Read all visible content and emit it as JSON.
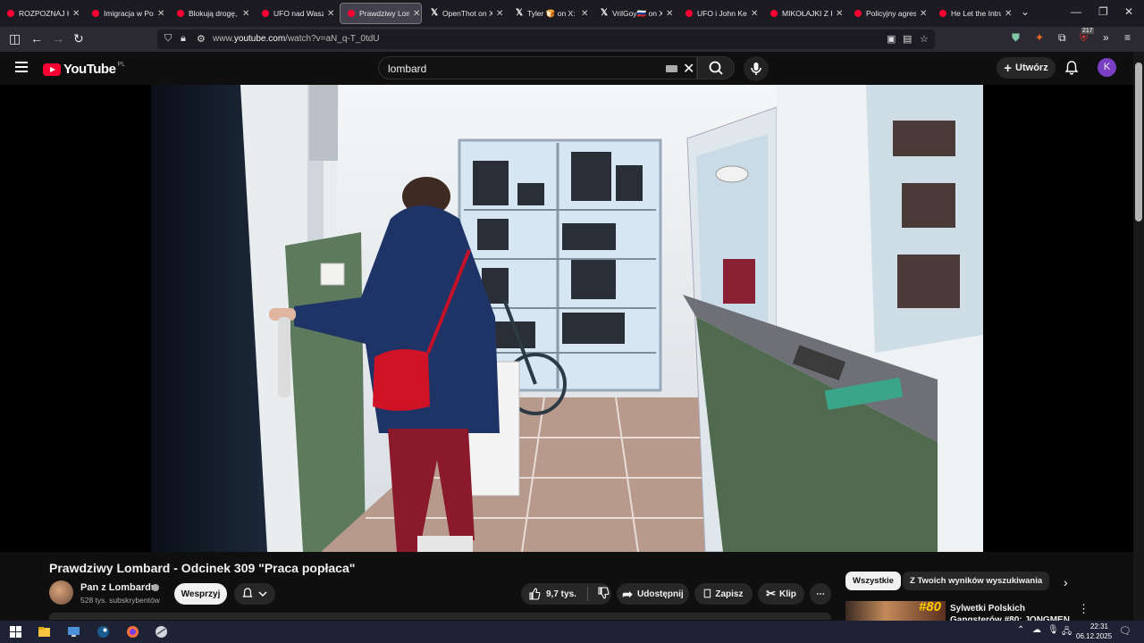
{
  "browser": {
    "tabs": [
      {
        "label": "ROZPOZNAJ KO",
        "icon": "youtube-icon"
      },
      {
        "label": "Imigracja w Pols",
        "icon": "youtube-icon"
      },
      {
        "label": "Blokują drogę, z",
        "icon": "youtube-icon"
      },
      {
        "label": "UFO nad Waszyn",
        "icon": "youtube-icon"
      },
      {
        "label": "Prawdziwy Lomb",
        "icon": "youtube-icon",
        "active": true
      },
      {
        "label": "OpenThot on X: ",
        "icon": "x-icon"
      },
      {
        "label": "Tyler 🍞 on X: \"I",
        "icon": "x-icon"
      },
      {
        "label": "VrilGoy🇷🇺 on X: ",
        "icon": "x-icon"
      },
      {
        "label": "UFO i John Kenn",
        "icon": "youtube-icon"
      },
      {
        "label": "MIKOŁAJKI Z KA",
        "icon": "youtube-icon"
      },
      {
        "label": "Policyjny agresc",
        "icon": "youtube-icon"
      },
      {
        "label": "He Let the Intru",
        "icon": "youtube-icon"
      }
    ],
    "url_prefix": "www.",
    "url_domain": "youtube.com",
    "url_path": "/watch?v=aN_q-T_0tdU",
    "badge_count": "217"
  },
  "youtube": {
    "logo_text": "YouTube",
    "country_code": "PL",
    "search_query": "lombard",
    "create_label": "Utwórz",
    "avatar_letter": "K"
  },
  "video": {
    "title": "Prawdziwy Lombard - Odcinek 309 \"Praca popłaca\"",
    "channel": "Pan z Lombardu",
    "subscribers": "528 tys. subskrybentów",
    "support_label": "Wesprzyj",
    "likes": "9,7 tys.",
    "share_label": "Udostępnij",
    "save_label": "Zapisz",
    "clip_label": "Klip"
  },
  "recommendations": {
    "chips": [
      "Wszystkie",
      "Z Twoich wyników wyszukiwania"
    ],
    "first_title": "Sylwetki Polskich Gangsterów #80: JONGMEN",
    "first_thumb_text": "#80"
  },
  "taskbar": {
    "time": "22:31",
    "date": "06.12.2025"
  },
  "colors": {
    "youtube_red": "#ff0033",
    "avatar_purple": "#7b3fc5",
    "background": "#0f0f0f"
  }
}
